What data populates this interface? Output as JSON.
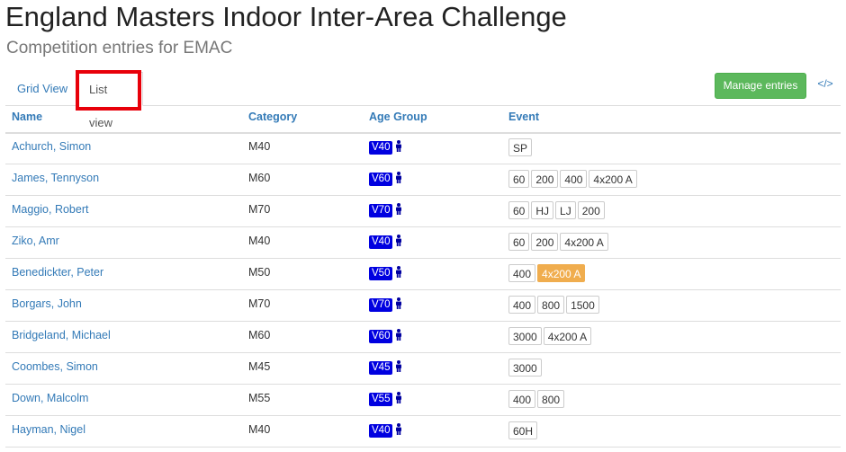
{
  "header": {
    "title": "England Masters Indoor Inter-Area Challenge",
    "subtitle": "Competition entries for EMAC"
  },
  "tabs": [
    {
      "label": "Grid View",
      "active": false
    },
    {
      "label": "List view",
      "active": true
    }
  ],
  "toolbar": {
    "manage_label": "Manage entries",
    "code_icon_label": "</>"
  },
  "columns": {
    "name": "Name",
    "category": "Category",
    "age_group": "Age Group",
    "event": "Event"
  },
  "colors": {
    "accent": "#337ab7",
    "success": "#5cb85c",
    "badge": "#0000e0",
    "highlight_event": "#f0ad4e",
    "annotation": "#e8000a"
  },
  "rows": [
    {
      "name": "Achurch, Simon",
      "category": "M40",
      "age": "V40",
      "events": [
        {
          "label": "SP"
        }
      ]
    },
    {
      "name": "James, Tennyson",
      "category": "M60",
      "age": "V60",
      "events": [
        {
          "label": "60"
        },
        {
          "label": "200"
        },
        {
          "label": "400"
        },
        {
          "label": "4x200 A"
        }
      ]
    },
    {
      "name": "Maggio, Robert",
      "category": "M70",
      "age": "V70",
      "events": [
        {
          "label": "60"
        },
        {
          "label": "HJ"
        },
        {
          "label": "LJ"
        },
        {
          "label": "200"
        }
      ]
    },
    {
      "name": "Ziko, Amr",
      "category": "M40",
      "age": "V40",
      "events": [
        {
          "label": "60"
        },
        {
          "label": "200"
        },
        {
          "label": "4x200 A"
        }
      ]
    },
    {
      "name": "Benedickter, Peter",
      "category": "M50",
      "age": "V50",
      "events": [
        {
          "label": "400"
        },
        {
          "label": "4x200 A",
          "highlight": true
        }
      ]
    },
    {
      "name": "Borgars, John",
      "category": "M70",
      "age": "V70",
      "events": [
        {
          "label": "400"
        },
        {
          "label": "800"
        },
        {
          "label": "1500"
        }
      ]
    },
    {
      "name": "Bridgeland, Michael",
      "category": "M60",
      "age": "V60",
      "events": [
        {
          "label": "3000"
        },
        {
          "label": "4x200 A"
        }
      ]
    },
    {
      "name": "Coombes, Simon",
      "category": "M45",
      "age": "V45",
      "events": [
        {
          "label": "3000"
        }
      ]
    },
    {
      "name": "Down, Malcolm",
      "category": "M55",
      "age": "V55",
      "events": [
        {
          "label": "400"
        },
        {
          "label": "800"
        }
      ]
    },
    {
      "name": "Hayman, Nigel",
      "category": "M40",
      "age": "V40",
      "events": [
        {
          "label": "60H"
        }
      ]
    }
  ]
}
